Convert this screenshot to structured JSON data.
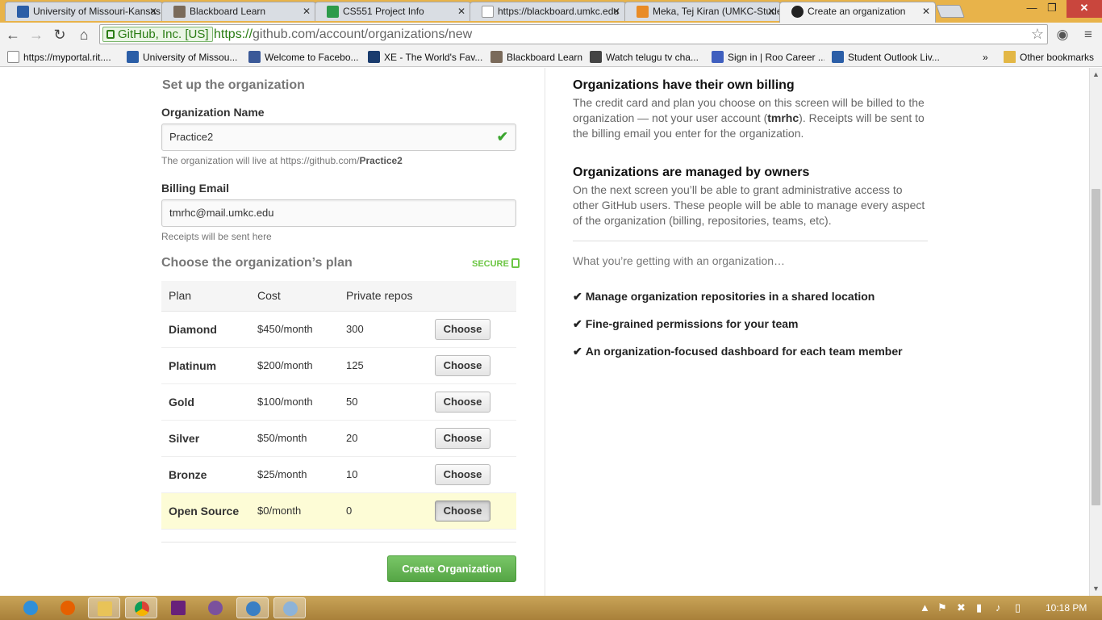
{
  "browser": {
    "tabs": [
      {
        "title": "University of Missouri-Kansas City",
        "active": false
      },
      {
        "title": "Blackboard Learn",
        "active": false
      },
      {
        "title": "CS551 Project Info",
        "active": false
      },
      {
        "title": "https://blackboard.umkc.edu",
        "active": false
      },
      {
        "title": "Meka, Tej Kiran (UMKC-Student)",
        "active": false
      },
      {
        "title": "Create an organization",
        "active": true
      }
    ],
    "ev_label": "GitHub, Inc. [US]",
    "url_scheme": "https://",
    "url_rest": "github.com/account/organizations/new",
    "bookmarks": [
      "https://myportal.rit....",
      "University of Missou...",
      "Welcome to Facebo...",
      "XE - The World's Fav...",
      "Blackboard Learn",
      "Watch telugu tv cha...",
      "Sign in | Roo Career ...",
      "Student Outlook Liv..."
    ],
    "bookmarks_overflow": "»",
    "other_bookmarks": "Other bookmarks"
  },
  "form": {
    "setup_heading": "Set up the organization",
    "org_name_label": "Organization Name",
    "org_name_value": "Practice2",
    "org_url_note_prefix": "The organization will live at https://github.com/",
    "org_url_note_name": "Practice2",
    "billing_label": "Billing Email",
    "billing_value": "tmrhc@mail.umkc.edu",
    "billing_note": "Receipts will be sent here",
    "plan_heading": "Choose the organization’s plan",
    "secure_label": "SECURE",
    "plan_columns": [
      "Plan",
      "Cost",
      "Private repos"
    ],
    "plans": [
      {
        "name": "Diamond",
        "cost": "$450/month",
        "repos": "300",
        "button": "Choose"
      },
      {
        "name": "Platinum",
        "cost": "$200/month",
        "repos": "125",
        "button": "Choose"
      },
      {
        "name": "Gold",
        "cost": "$100/month",
        "repos": "50",
        "button": "Choose"
      },
      {
        "name": "Silver",
        "cost": "$50/month",
        "repos": "20",
        "button": "Choose"
      },
      {
        "name": "Bronze",
        "cost": "$25/month",
        "repos": "10",
        "button": "Choose"
      },
      {
        "name": "Open Source",
        "cost": "$0/month",
        "repos": "0",
        "button": "Choose"
      }
    ],
    "selected_plan": "Open Source",
    "create_button": "Create Organization"
  },
  "info": {
    "billing_heading": "Organizations have their own billing",
    "billing_text_1": "The credit card and plan you choose on this screen will be billed to the organization — not your user account (",
    "billing_username": "tmrhc",
    "billing_text_2": "). Receipts will be sent to the billing email you enter for the organization.",
    "owners_heading": "Organizations are managed by owners",
    "owners_text": "On the next screen you’ll be able to grant administrative access to other GitHub users. These people will be able to manage every aspect of the organization (billing, repositories, teams, etc).",
    "getting_text": "What you’re getting with an organization…",
    "features": [
      "Manage organization repositories in a shared location",
      "Fine-grained permissions for your team",
      "An organization-focused dashboard for each team member"
    ]
  },
  "taskbar": {
    "clock": "10:18 PM"
  },
  "colors": {
    "create_button_green": "#6cc644",
    "selected_row": "#fdfcd6",
    "taskbar": "#b88f45"
  }
}
